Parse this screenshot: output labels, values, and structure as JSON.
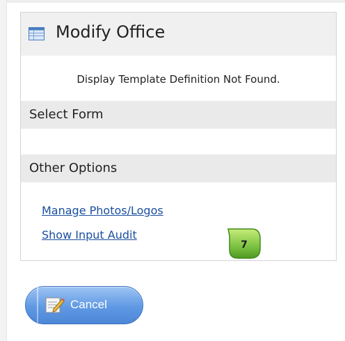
{
  "panel": {
    "title": "Modify Office",
    "icon": "table-form-icon",
    "message": "Display Template Definition Not Found."
  },
  "sections": {
    "select_form": "Select Form",
    "other_options": "Other Options"
  },
  "links": {
    "manage_photos": "Manage Photos/Logos",
    "show_input_audit": "Show Input Audit"
  },
  "badge": {
    "number": "7",
    "color": "#7cc242"
  },
  "cancel_button": {
    "label": "Cancel",
    "icon": "edit-cancel-icon",
    "color": "#5f99e4"
  }
}
